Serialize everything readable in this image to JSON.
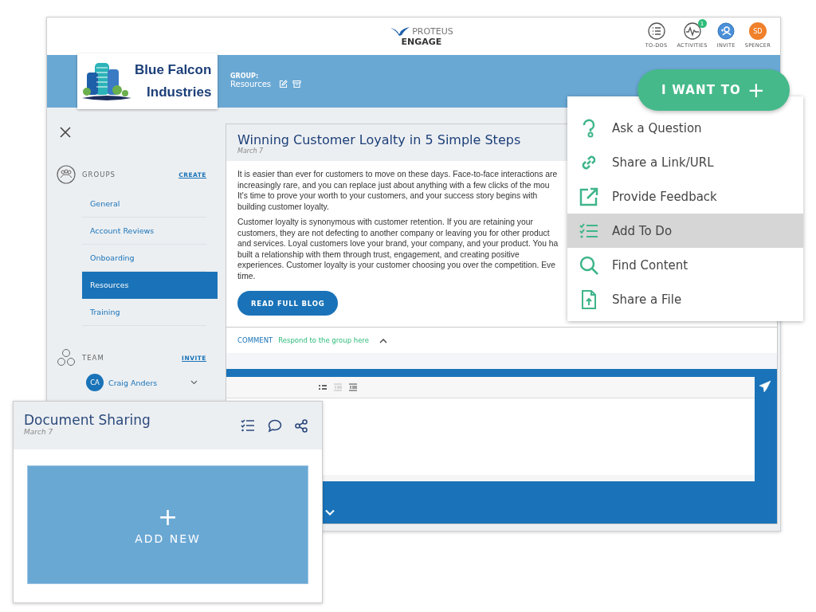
{
  "header": {
    "brand_top": "PROTEUS",
    "brand_bottom": "ENGAGE",
    "actions": [
      {
        "label": "TO-DOS",
        "kind": "list"
      },
      {
        "label": "ACTIVITIES",
        "kind": "activity",
        "badge": "1"
      },
      {
        "label": "INVITE",
        "kind": "invite"
      },
      {
        "label": "SPENCER",
        "kind": "avatar",
        "initials": "SD"
      }
    ]
  },
  "company": {
    "line1": "Blue Falcon",
    "line2": "Industries"
  },
  "group": {
    "label": "GROUP:",
    "name": "Resources"
  },
  "sidebar": {
    "groups_title": "GROUPS",
    "create_link": "CREATE",
    "groups": [
      {
        "label": "General",
        "selected": false
      },
      {
        "label": "Account Reviews",
        "selected": false
      },
      {
        "label": "Onboarding",
        "selected": false
      },
      {
        "label": "Resources",
        "selected": true
      },
      {
        "label": "Training",
        "selected": false
      }
    ],
    "team_title": "TEAM",
    "invite_link": "INVITE",
    "members": [
      {
        "initials": "CA",
        "name": "Craig Anders"
      }
    ]
  },
  "article": {
    "title": "Winning Customer Loyalty in 5 Simple Steps",
    "date": "March 7",
    "paragraphs": [
      "It is easier than ever for customers to move on these days. Face-to-face interactions are increasingly rare, and you can replace just about anything with a few clicks of the mou It's time to prove your worth to your customers, and your success story begins with building customer loyalty.",
      "Customer loyalty is synonymous with customer retention. If you are retaining your customers, they are not defecting to another company or leaving you for other product and services. Loyal customers love your brand, your company, and your product. You ha built a relationship with them through trust, engagement, and creating positive experiences. Customer loyalty is your customer choosing you over the competition. Eve time."
    ],
    "button": "READ FULL BLOG"
  },
  "comment": {
    "label": "COMMENT",
    "prompt": "Respond to the group here"
  },
  "i_want_to": {
    "label": "I WANT TO",
    "plus": "+",
    "items": [
      {
        "label": "Ask a Question",
        "selected": false
      },
      {
        "label": "Share a Link/URL",
        "selected": false
      },
      {
        "label": "Provide Feedback",
        "selected": false
      },
      {
        "label": "Add To Do",
        "selected": true
      },
      {
        "label": "Find Content",
        "selected": false
      },
      {
        "label": "Share a File",
        "selected": false
      }
    ]
  },
  "document_card": {
    "title": "Document Sharing",
    "date": "March 7",
    "add_plus": "+",
    "add_label": "ADD NEW"
  }
}
